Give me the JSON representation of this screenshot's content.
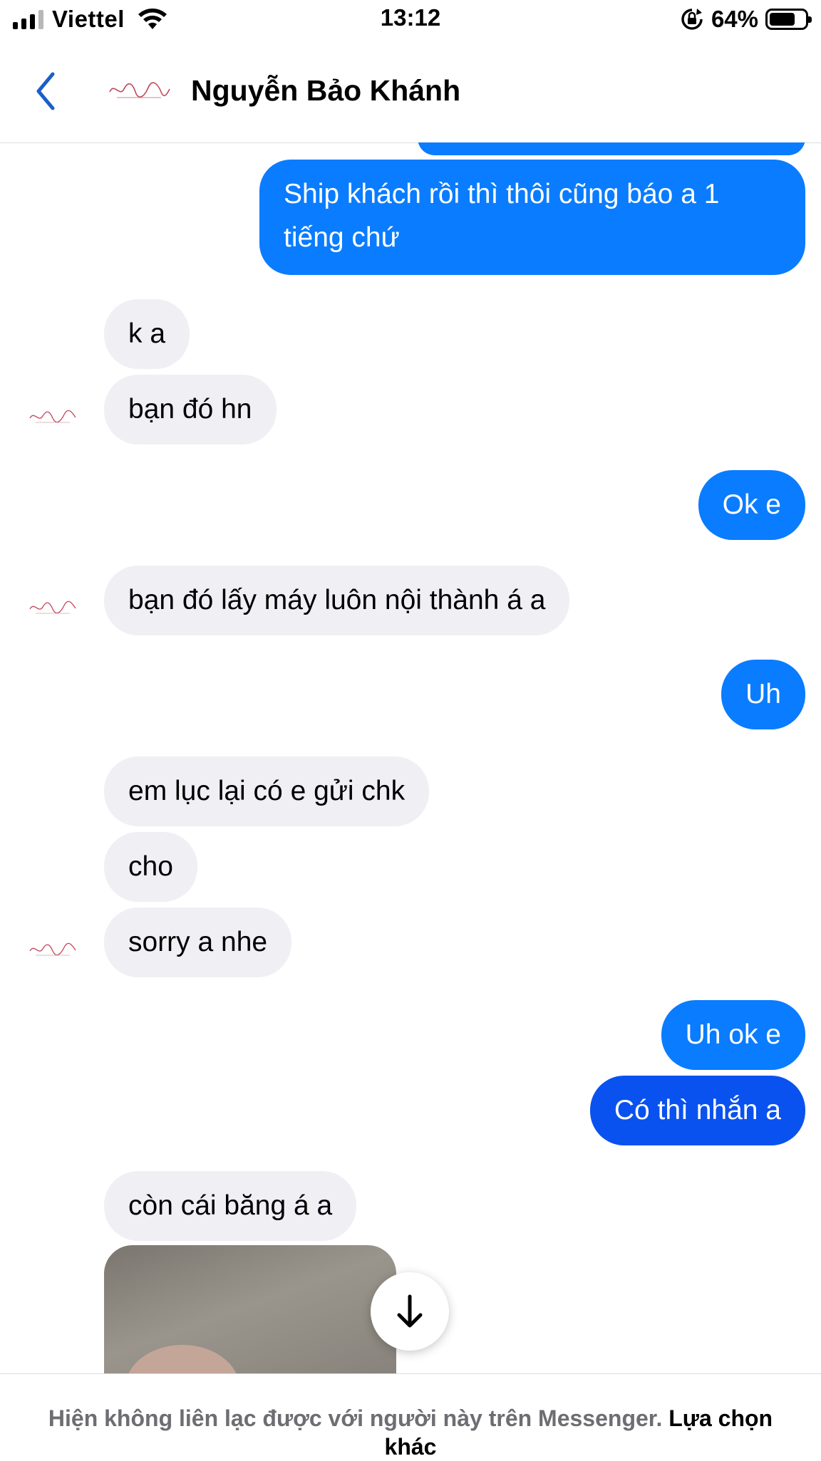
{
  "status_bar": {
    "carrier": "Viettel",
    "time": "13:12",
    "battery_percent": "64%",
    "battery_level": 0.64,
    "signal_bars_active": 3,
    "icons": [
      "signal-icon",
      "wifi-icon",
      "rotation-lock-icon",
      "battery-icon"
    ]
  },
  "header": {
    "contact_name": "Nguyễn Bảo Khánh",
    "back_icon": "chevron-left-icon",
    "avatar": "contact-avatar-logo"
  },
  "messages": [
    {
      "direction": "outgoing",
      "text": "Ship khách rồi thì thôi cũng báo a 1 tiếng chứ"
    },
    {
      "direction": "incoming",
      "text": "k a"
    },
    {
      "direction": "incoming",
      "text": "bạn đó hn"
    },
    {
      "direction": "outgoing",
      "text": "Ok e"
    },
    {
      "direction": "incoming",
      "text": "bạn đó lấy máy luôn nội thành á a"
    },
    {
      "direction": "outgoing",
      "text": "Uh"
    },
    {
      "direction": "incoming",
      "text": "em lục lại có e gửi chk"
    },
    {
      "direction": "incoming",
      "text": "cho"
    },
    {
      "direction": "incoming",
      "text": "sorry a nhe"
    },
    {
      "direction": "outgoing",
      "text": "Uh ok e"
    },
    {
      "direction": "outgoing",
      "text": "Có thì nhắn a"
    },
    {
      "direction": "incoming",
      "text": "còn cái băng á a"
    },
    {
      "direction": "incoming",
      "type": "photo"
    }
  ],
  "scroll_button": {
    "icon": "arrow-down-icon"
  },
  "footer": {
    "notice": "Hiện không liên lạc được với người này trên Messenger.",
    "link": "Lựa chọn khác"
  },
  "colors": {
    "outgoing_bubble": "#0a7cff",
    "outgoing_bubble_deep": "#0a52ef",
    "incoming_bubble": "#efeff4",
    "accent": "#1a5fc9"
  }
}
